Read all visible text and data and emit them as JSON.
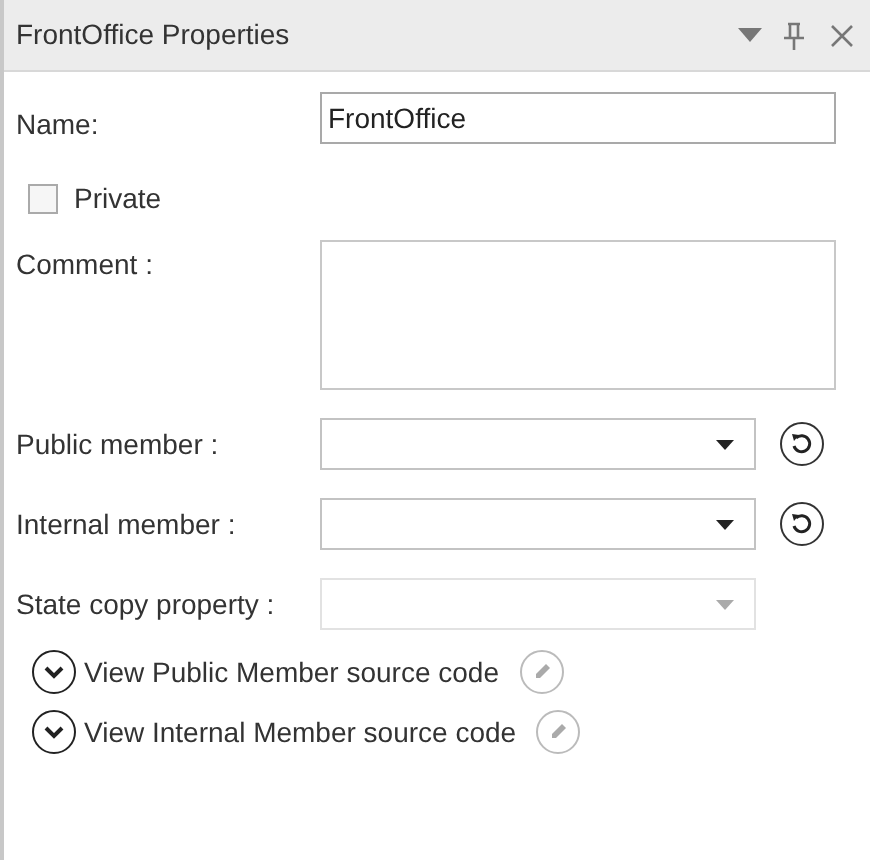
{
  "panel": {
    "title": "FrontOffice Properties"
  },
  "name_field": {
    "label": "Name:",
    "value": "FrontOffice"
  },
  "private_checkbox": {
    "label": "Private",
    "checked": false
  },
  "comment_field": {
    "label": "Comment :"
  },
  "dropdowns": [
    {
      "label": "Public member :",
      "disabled": false,
      "reset_button": true
    },
    {
      "label": "Internal member :",
      "disabled": false,
      "reset_button": true
    },
    {
      "label": "State copy property :",
      "disabled": true,
      "reset_button": false
    }
  ],
  "expanders": [
    {
      "label": "View Public Member source code",
      "expanded": false
    },
    {
      "label": "View Internal Member source code",
      "expanded": false
    }
  ]
}
